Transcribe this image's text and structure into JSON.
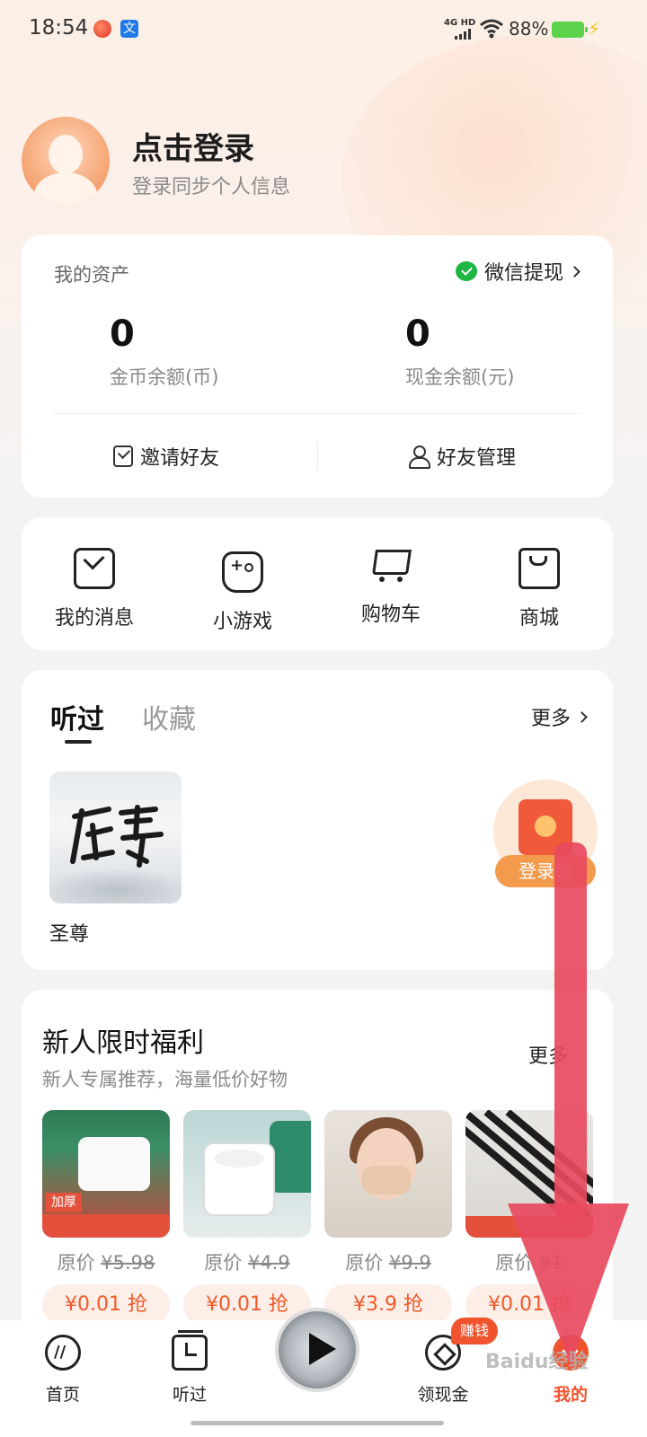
{
  "status_bar": {
    "time": "18:54",
    "network": "4G HD",
    "battery_percent": "88%",
    "battery_level": 0.88
  },
  "profile": {
    "title": "点击登录",
    "subtitle": "登录同步个人信息"
  },
  "assets": {
    "title": "我的资产",
    "wechat_withdraw": "微信提现",
    "coins": {
      "value": "0",
      "label": "金币余额(币)"
    },
    "cash": {
      "value": "0",
      "label": "现金余额(元)"
    },
    "invite": "邀请好友",
    "friends": "好友管理"
  },
  "shortcuts": [
    {
      "label": "我的消息",
      "icon": "message-icon"
    },
    {
      "label": "小游戏",
      "icon": "gamepad-icon"
    },
    {
      "label": "购物车",
      "icon": "cart-icon"
    },
    {
      "label": "商城",
      "icon": "shopping-bag-icon"
    }
  ],
  "history": {
    "tabs": [
      "听过",
      "收藏"
    ],
    "active_tab": "听过",
    "more": "更多",
    "books": [
      {
        "title": "圣尊"
      }
    ],
    "red_packet_label": "登录领"
  },
  "welfare": {
    "title": "新人限时福利",
    "subtitle": "新人专属推荐，海量低价好物",
    "more": "更多",
    "products": [
      {
        "orig_prefix": "原价",
        "orig_price": "¥5.98",
        "button": "¥0.01 抢",
        "img_tag": "加厚"
      },
      {
        "orig_prefix": "原价",
        "orig_price": "¥4.9",
        "button": "¥0.01 抢"
      },
      {
        "orig_prefix": "原价",
        "orig_price": "¥9.9",
        "button": "¥3.9 抢"
      },
      {
        "orig_prefix": "原价",
        "orig_price": "¥1",
        "button": "¥0.01 抢"
      }
    ]
  },
  "bottom_nav": {
    "items": [
      {
        "label": "首页",
        "icon": "home-icon"
      },
      {
        "label": "听过",
        "icon": "history-icon"
      },
      {
        "label": "领现金",
        "icon": "cash-icon"
      },
      {
        "label": "我的",
        "icon": "mine-icon"
      }
    ],
    "active": "我的",
    "earn_badge": "赚钱"
  },
  "watermark": "Baidu经验",
  "colors": {
    "accent": "#f0542e",
    "arrow": "#e84a5f",
    "wechat": "#1cb541"
  }
}
